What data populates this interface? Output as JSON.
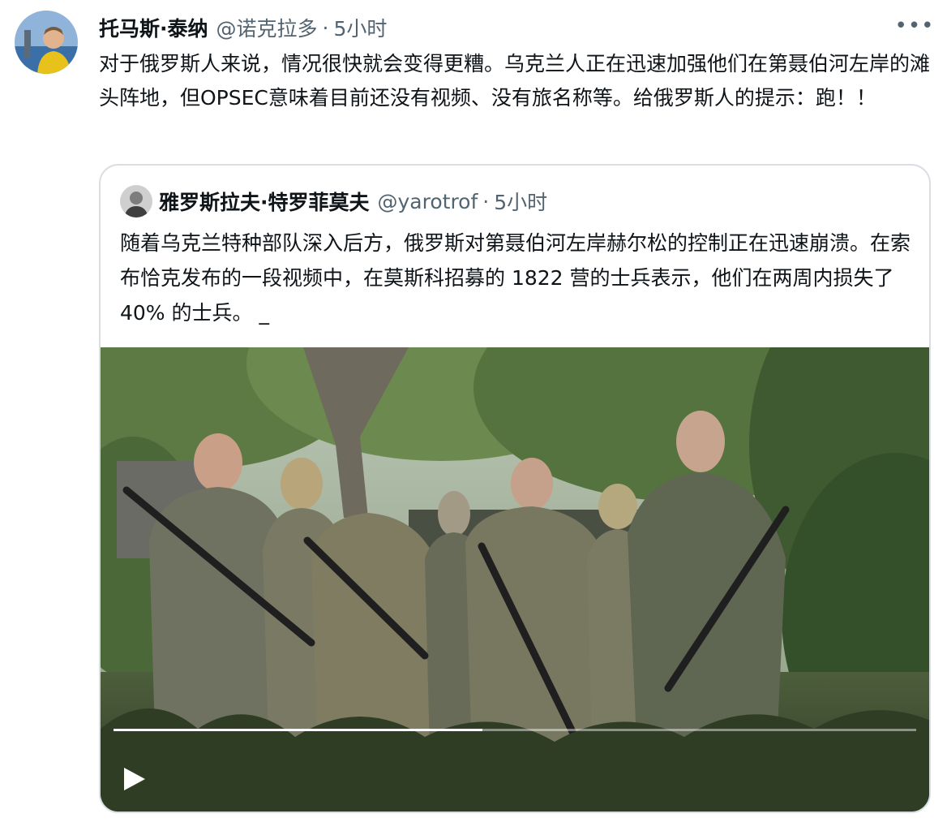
{
  "tweet": {
    "author_name": "托马斯·泰纳",
    "author_handle": "@诺克拉多",
    "separator": "·",
    "time": "5小时",
    "more": "•••",
    "text": "对于俄罗斯人来说，情况很快就会变得更糟。乌克兰人正在迅速加强他们在第聂伯河左岸的滩头阵地，但OPSEC意味着目前还没有视频、没有旅名称等。给俄罗斯人的提示：跑！！"
  },
  "quoted_tweet": {
    "author_name": "雅罗斯拉夫·特罗菲莫夫",
    "author_handle": "@yarotrof",
    "separator": "·",
    "time": "5小时",
    "text": "随着乌克兰特种部队深入后方，俄罗斯对第聂伯河左岸赫尔松的控制正在迅速崩溃。在索布恰克发布的一段视频中，在莫斯科招募的 1822 营的士兵表示，他们在两周内损失了 40% 的士兵。 _"
  },
  "video": {
    "progress": 0.46,
    "play_icon": "play-icon"
  },
  "colors": {
    "text": "#0f1419",
    "secondary": "#536471",
    "border": "#d9dee3"
  }
}
